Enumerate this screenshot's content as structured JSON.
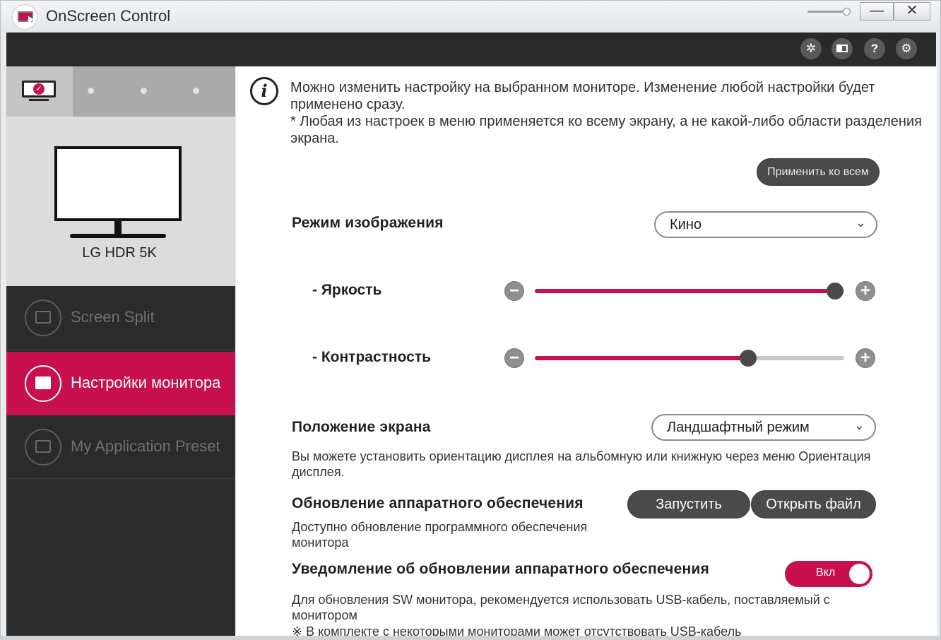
{
  "window": {
    "title": "OnScreen Control",
    "minimize_symbol": "—",
    "close_symbol": "✕",
    "transparency_level": 0.9
  },
  "toolbar": {
    "icons": [
      "cursor-click-icon",
      "window-layout-icon",
      "help-icon",
      "settings-gear-icon"
    ],
    "help_symbol": "?",
    "settings_symbol": "⚙",
    "cursor_symbol": "✲"
  },
  "sidebar": {
    "monitor_tab_check": "✓",
    "monitor_name": "LG HDR 5K",
    "items": [
      {
        "label": "Screen Split",
        "active": false
      },
      {
        "label": "Настройки монитора",
        "active": true
      },
      {
        "label": "My Application Preset",
        "active": false
      }
    ]
  },
  "main": {
    "info_symbol": "i",
    "info_line1": "Можно изменить настройку на выбранном мониторе. Изменение любой настройки будет применено сразу.",
    "info_line2": "* Любая из настроек в меню применяется ко всему экрану, а не какой-либо области разделения экрана.",
    "apply_all_label": "Применить ко всем",
    "picture_mode": {
      "label": "Режим изображения",
      "value": "Кино"
    },
    "brightness": {
      "label": "- Яркость",
      "value_fraction": 0.97
    },
    "contrast": {
      "label": "- Контрастность",
      "value_fraction": 0.69
    },
    "minus_symbol": "−",
    "plus_symbol": "+",
    "screen_position": {
      "label": "Положение экрана",
      "value": "Ландшафтный режим",
      "description": "Вы можете установить ориентацию дисплея на альбомную или книжную через меню Ориентация дисплея."
    },
    "firmware_update": {
      "label": "Обновление аппаратного обеспечения",
      "run_label": "Запустить",
      "open_label": "Открыть файл",
      "description": "Доступно обновление программного обеспечения монитора"
    },
    "update_notification": {
      "label": "Уведомление об обновлении аппаратного обеспечения",
      "toggle_label": "Вкл",
      "description": "Для обновления SW монитора, рекомендуется использовать USB-кабель, поставляемый с монитором",
      "cut_text": "※ В комплекте с некоторыми мониторами может отсутствовать USB-кабель"
    },
    "chevron": "⌄"
  },
  "colors": {
    "accent": "#c8104e",
    "dark": "#2b2b2b",
    "button_dark": "#4a4a4a"
  }
}
